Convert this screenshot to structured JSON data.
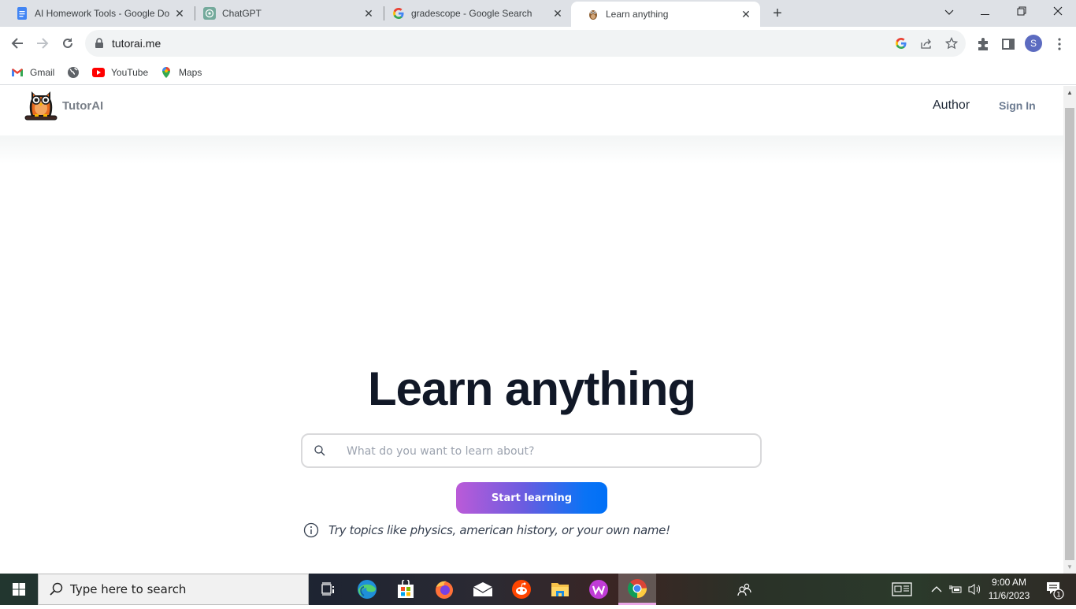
{
  "browser": {
    "tabs": [
      {
        "title": "AI Homework Tools - Google Do",
        "icon": "google-docs-icon",
        "active": false
      },
      {
        "title": "ChatGPT",
        "icon": "chatgpt-icon",
        "active": false
      },
      {
        "title": "gradescope - Google Search",
        "icon": "google-icon",
        "active": false
      },
      {
        "title": "Learn anything",
        "icon": "owl-icon",
        "active": true
      }
    ],
    "close_glyph": "✕",
    "new_tab_glyph": "+",
    "window_controls": {
      "tab_search": "⌄",
      "minimize": "—",
      "restore": "❐",
      "close": "✕"
    },
    "url": "tutorai.me",
    "profile_initial": "S",
    "bookmarks": [
      {
        "label": "Gmail",
        "icon": "gmail-icon"
      },
      {
        "label": "",
        "icon": "globe-icon"
      },
      {
        "label": "YouTube",
        "icon": "youtube-icon"
      },
      {
        "label": "Maps",
        "icon": "maps-icon"
      }
    ]
  },
  "site": {
    "brand": "TutorAI",
    "nav": {
      "author": "Author",
      "sign_in": "Sign In"
    },
    "hero_title": "Learn anything",
    "search_placeholder": "What do you want to learn about?",
    "search_value": "",
    "start_button": "Start learning",
    "hint": "Try topics like physics, american history, or your own name!",
    "colors": {
      "brand_gradient_start": "#bb5bd8",
      "brand_gradient_end": "#0070f7",
      "title": "#111827"
    }
  },
  "taskbar": {
    "search_placeholder": "Type here to search",
    "apps": [
      "task-view",
      "edge",
      "microsoft-store",
      "firefox",
      "mail",
      "reddit",
      "file-explorer",
      "wps-office",
      "chrome"
    ],
    "time": "9:00 AM",
    "date": "11/6/2023",
    "notification_count": "1"
  }
}
